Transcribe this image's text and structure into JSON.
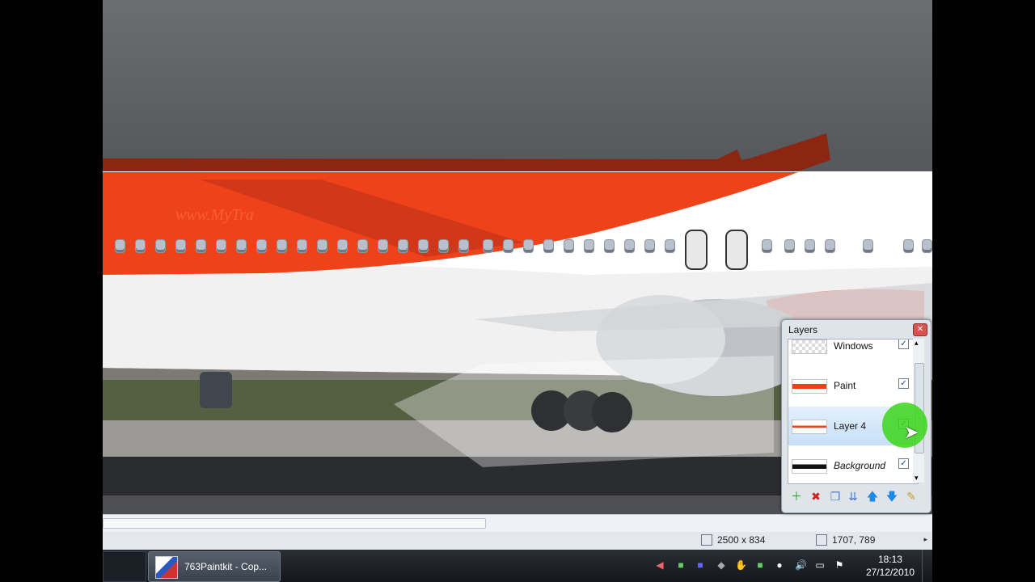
{
  "canvas": {
    "website_text": "www.MyTra"
  },
  "status_bar": {
    "image_size": "2500 x 834",
    "cursor_position": "1707, 789"
  },
  "layers_panel": {
    "title": "Layers",
    "layers": [
      {
        "name": "Windows",
        "visible": true
      },
      {
        "name": "Paint",
        "visible": true
      },
      {
        "name": "Layer 4",
        "visible": true,
        "selected": true
      },
      {
        "name": "Background",
        "visible": true
      }
    ],
    "toolbar_icons": [
      "add-layer-icon",
      "delete-layer-icon",
      "duplicate-layer-icon",
      "merge-layer-down-icon",
      "move-layer-up-icon",
      "move-layer-down-icon",
      "layer-properties-icon"
    ]
  },
  "taskbar": {
    "task_label": "763Paintkit - Cop...",
    "clock_time": "18:13",
    "clock_date": "27/12/2010"
  },
  "colors": {
    "livery_orange": "#f0421a",
    "livery_dark": "#8a2611",
    "selection_blue": "#c7e0f8",
    "cursor_highlight": "#3bd61a"
  }
}
